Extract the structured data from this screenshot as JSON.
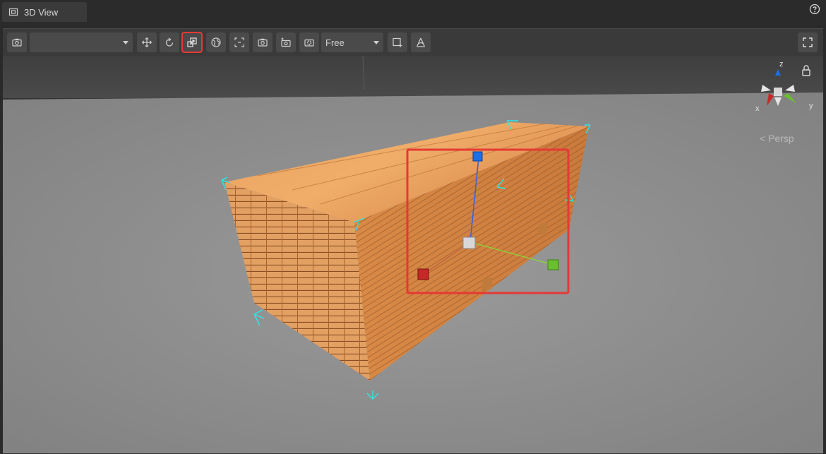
{
  "tab": {
    "title": "3D View",
    "icon": "scene-view-icon"
  },
  "toolbar": {
    "camera_dropdown_value": "",
    "view_mode_value": "Free"
  },
  "viewport": {
    "projection_label": "< Persp",
    "axis_labels": {
      "x": "x",
      "y": "y",
      "z": "z"
    }
  },
  "colors": {
    "accent_highlight": "#e53935",
    "axis_x": "#c62828",
    "axis_y": "#6abf2e",
    "axis_z": "#1e6fe0",
    "selection_corners": "#2ee6e6"
  }
}
